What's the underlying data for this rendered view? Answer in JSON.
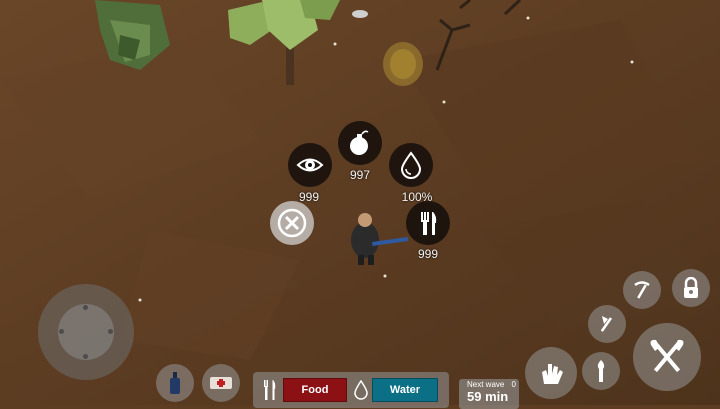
{
  "hud": {
    "radial_menu": [
      {
        "icon": "eye-icon",
        "value": "999"
      },
      {
        "icon": "bomb-icon",
        "value": "997"
      },
      {
        "icon": "water-drop-icon",
        "value": "100%"
      },
      {
        "icon": "fork-knife-icon",
        "value": "999"
      }
    ],
    "status_bars": {
      "food_label": "Food",
      "water_label": "Water",
      "food_color": "#8b1114",
      "water_color": "#0b6f86"
    },
    "next_wave": {
      "label": "Next wave",
      "count": "0",
      "time": "59 min"
    }
  },
  "colors": {
    "ground": "#5c3d22",
    "button_bg": "#969696"
  }
}
